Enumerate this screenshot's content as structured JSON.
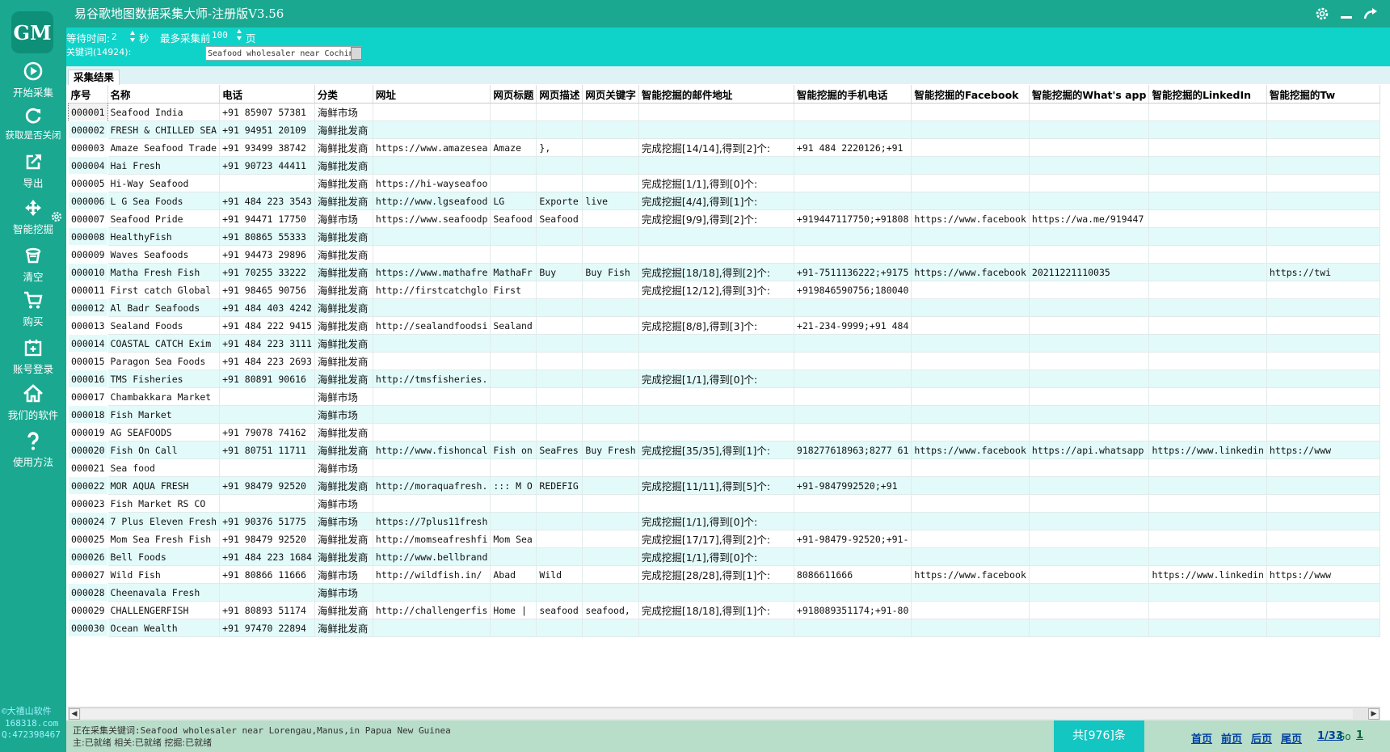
{
  "app": {
    "title": "易谷歌地图数据采集大师-注册版V3.56",
    "logo": "GM"
  },
  "colors": {
    "accent": "#1aa891",
    "param_bar": "#0fd3c9",
    "row_alt": "#e2fbfa",
    "status_bar": "#b8ddc9",
    "link": "#0040a0"
  },
  "sidebar": {
    "items": [
      {
        "label": "开始采集",
        "icon": "play-circle-icon"
      },
      {
        "label": "获取是否关闭",
        "icon": "refresh-icon"
      },
      {
        "label": "导出",
        "icon": "export-icon"
      },
      {
        "label": "智能挖掘",
        "icon": "move-arrows-icon"
      },
      {
        "label": "清空",
        "icon": "trash-icon"
      },
      {
        "label": "购买",
        "icon": "cart-icon"
      },
      {
        "label": "账号登录",
        "icon": "calendar-add-icon"
      },
      {
        "label": "我们的软件",
        "icon": "home-icon"
      },
      {
        "label": "使用方法",
        "icon": "question-icon"
      }
    ],
    "brand_lines": [
      "©大禧山软件",
      "168318.com",
      "Q:472398467"
    ]
  },
  "params": {
    "wait_label": "等待时间:",
    "wait_value": "2",
    "wait_unit": "秒",
    "max_label": "最多采集前",
    "max_value": "100",
    "max_unit": "页",
    "keyword_label": "关键词(14924):",
    "keyword_value": "Seafood wholesaler near Cochin"
  },
  "tabs": [
    "采集结果"
  ],
  "table": {
    "columns": [
      "序号",
      "名称",
      "电话",
      "分类",
      "网址",
      "网页标题",
      "网页描述",
      "网页关键字",
      "智能挖掘的邮件地址",
      "智能挖掘的手机电话",
      "智能挖掘的Facebook",
      "智能挖掘的What's app",
      "智能挖掘的LinkedIn",
      "智能挖掘的Tw"
    ],
    "rows": [
      [
        "000001",
        "Seafood India",
        "+91 85907 57381",
        "海鲜市场",
        "",
        "",
        "",
        "",
        "",
        "",
        "",
        "",
        "",
        ""
      ],
      [
        "000002",
        "FRESH & CHILLED SEA",
        "+91 94951 20109",
        "海鲜批发商",
        "",
        "",
        "",
        "",
        "",
        "",
        "",
        "",
        "",
        ""
      ],
      [
        "000003",
        "Amaze Seafood Trade",
        "+91 93499 38742",
        "海鲜批发商",
        "https://www.amazesea",
        "Amaze",
        "},",
        "",
        "完成挖掘[14/14],得到[2]个:",
        "+91 484 2220126;+91",
        "",
        "",
        "",
        ""
      ],
      [
        "000004",
        "Hai Fresh",
        "+91 90723 44411",
        "海鲜批发商",
        "",
        "",
        "",
        "",
        "",
        "",
        "",
        "",
        "",
        ""
      ],
      [
        "000005",
        "Hi-Way Seafood",
        "",
        "海鲜批发商",
        "https://hi-wayseafoo",
        "",
        "",
        "",
        "完成挖掘[1/1],得到[0]个:",
        "",
        "",
        "",
        "",
        ""
      ],
      [
        "000006",
        "L G Sea Foods",
        "+91 484 223 3543",
        "海鲜批发商",
        "http://www.lgseafood",
        "LG",
        "Exporte",
        "live",
        "完成挖掘[4/4],得到[1]个:",
        "",
        "",
        "",
        "",
        ""
      ],
      [
        "000007",
        "Seafood Pride",
        "+91 94471 17750",
        "海鲜市场",
        "https://www.seafoodp",
        "Seafood",
        "Seafood",
        "",
        "完成挖掘[9/9],得到[2]个:",
        "+919447117750;+91808",
        "https://www.facebook",
        "https://wa.me/919447",
        "",
        ""
      ],
      [
        "000008",
        "HealthyFish",
        "+91 80865 55333",
        "海鲜批发商",
        "",
        "",
        "",
        "",
        "",
        "",
        "",
        "",
        "",
        ""
      ],
      [
        "000009",
        "Waves Seafoods",
        "+91 94473 29896",
        "海鲜批发商",
        "",
        "",
        "",
        "",
        "",
        "",
        "",
        "",
        "",
        ""
      ],
      [
        "000010",
        "Matha Fresh Fish",
        "+91 70255 33222",
        "海鲜批发商",
        "https://www.mathafre",
        "MathaFr",
        "Buy",
        "Buy Fish",
        "完成挖掘[18/18],得到[2]个:",
        "+91-7511136222;+9175",
        "https://www.facebook",
        "20211221110035",
        "",
        "https://twi"
      ],
      [
        "000011",
        "First catch Global",
        "+91 98465 90756",
        "海鲜批发商",
        "http://firstcatchglo",
        "First",
        "",
        "",
        "完成挖掘[12/12],得到[3]个:",
        "+919846590756;180040",
        "",
        "",
        "",
        ""
      ],
      [
        "000012",
        "Al Badr Seafoods",
        "+91 484 403 4242",
        "海鲜批发商",
        "",
        "",
        "",
        "",
        "",
        "",
        "",
        "",
        "",
        ""
      ],
      [
        "000013",
        "Sealand Foods",
        "+91 484 222 9415",
        "海鲜批发商",
        "http://sealandfoodsi",
        "Sealand",
        "",
        "",
        "完成挖掘[8/8],得到[3]个:",
        "+21-234-9999;+91 484",
        "",
        "",
        "",
        ""
      ],
      [
        "000014",
        "COASTAL CATCH Exim",
        "+91 484 223 3111",
        "海鲜批发商",
        "",
        "",
        "",
        "",
        "",
        "",
        "",
        "",
        "",
        ""
      ],
      [
        "000015",
        "Paragon Sea Foods",
        "+91 484 223 2693",
        "海鲜批发商",
        "",
        "",
        "",
        "",
        "",
        "",
        "",
        "",
        "",
        ""
      ],
      [
        "000016",
        "TMS Fisheries",
        "+91 80891 90616",
        "海鲜批发商",
        "http://tmsfisheries.",
        "",
        "",
        "",
        "完成挖掘[1/1],得到[0]个:",
        "",
        "",
        "",
        "",
        ""
      ],
      [
        "000017",
        "Chambakkara Market",
        "",
        "海鲜市场",
        "",
        "",
        "",
        "",
        "",
        "",
        "",
        "",
        "",
        ""
      ],
      [
        "000018",
        "Fish Market",
        "",
        "海鲜市场",
        "",
        "",
        "",
        "",
        "",
        "",
        "",
        "",
        "",
        ""
      ],
      [
        "000019",
        "AG SEAFOODS",
        "+91 79078 74162",
        "海鲜批发商",
        "",
        "",
        "",
        "",
        "",
        "",
        "",
        "",
        "",
        ""
      ],
      [
        "000020",
        "Fish On Call",
        "+91 80751 11711",
        "海鲜批发商",
        "http://www.fishoncal",
        "Fish on",
        "SeaFres",
        "Buy Fresh",
        "完成挖掘[35/35],得到[1]个:",
        "918277618963;8277 61",
        "https://www.facebook",
        "https://api.whatsapp",
        "https://www.linkedin",
        "https://www"
      ],
      [
        "000021",
        "Sea food",
        "",
        "海鲜市场",
        "",
        "",
        "",
        "",
        "",
        "",
        "",
        "",
        "",
        ""
      ],
      [
        "000022",
        "MOR AQUA FRESH",
        "+91 98479 92520",
        "海鲜批发商",
        "http://moraquafresh.",
        "::: M O",
        "REDEFIG",
        "",
        "完成挖掘[11/11],得到[5]个:",
        "+91-9847992520;+91",
        "",
        "",
        "",
        ""
      ],
      [
        "000023",
        "Fish Market RS CO",
        "",
        "海鲜市场",
        "",
        "",
        "",
        "",
        "",
        "",
        "",
        "",
        "",
        ""
      ],
      [
        "000024",
        "7 Plus Eleven Fresh",
        "+91 90376 51775",
        "海鲜市场",
        "https://7plus11fresh",
        "",
        "",
        "",
        "完成挖掘[1/1],得到[0]个:",
        "",
        "",
        "",
        "",
        ""
      ],
      [
        "000025",
        "Mom Sea Fresh Fish",
        "+91 98479 92520",
        "海鲜批发商",
        "http://momseafreshfi",
        "Mom Sea",
        "",
        "",
        "完成挖掘[17/17],得到[2]个:",
        "+91-98479-92520;+91-",
        "",
        "",
        "",
        ""
      ],
      [
        "000026",
        "Bell Foods",
        "+91 484 223 1684",
        "海鲜批发商",
        "http://www.bellbrand",
        "",
        "",
        "",
        "完成挖掘[1/1],得到[0]个:",
        "",
        "",
        "",
        "",
        ""
      ],
      [
        "000027",
        "Wild Fish",
        "+91 80866 11666",
        "海鲜市场",
        "http://wildfish.in/",
        "Abad",
        "Wild",
        "",
        "完成挖掘[28/28],得到[1]个:",
        "8086611666",
        "https://www.facebook",
        "",
        "https://www.linkedin",
        "https://www"
      ],
      [
        "000028",
        "Cheenavala Fresh",
        "",
        "海鲜市场",
        "",
        "",
        "",
        "",
        "",
        "",
        "",
        "",
        "",
        ""
      ],
      [
        "000029",
        "CHALLENGERFISH",
        "+91 80893 51174",
        "海鲜批发商",
        "http://challengerfis",
        "Home |",
        "seafood",
        "seafood,",
        "完成挖掘[18/18],得到[1]个:",
        "+918089351174;+91-80",
        "",
        "",
        "",
        ""
      ],
      [
        "000030",
        "Ocean Wealth",
        "+91 97470 22894",
        "海鲜批发商",
        "",
        "",
        "",
        "",
        "",
        "",
        "",
        "",
        "",
        ""
      ]
    ]
  },
  "status": {
    "line1": "正在采集关键词:Seafood wholesaler near Lorengau,Manus,in Papua New Guinea",
    "line2": "主:已就绪  相关:已就绪  挖掘:已就绪",
    "count": "共[976]条",
    "first": "首页",
    "prev": "前页",
    "next": "后页",
    "last": "尾页",
    "page": "1/33",
    "go": "Go",
    "go_page": "1"
  }
}
